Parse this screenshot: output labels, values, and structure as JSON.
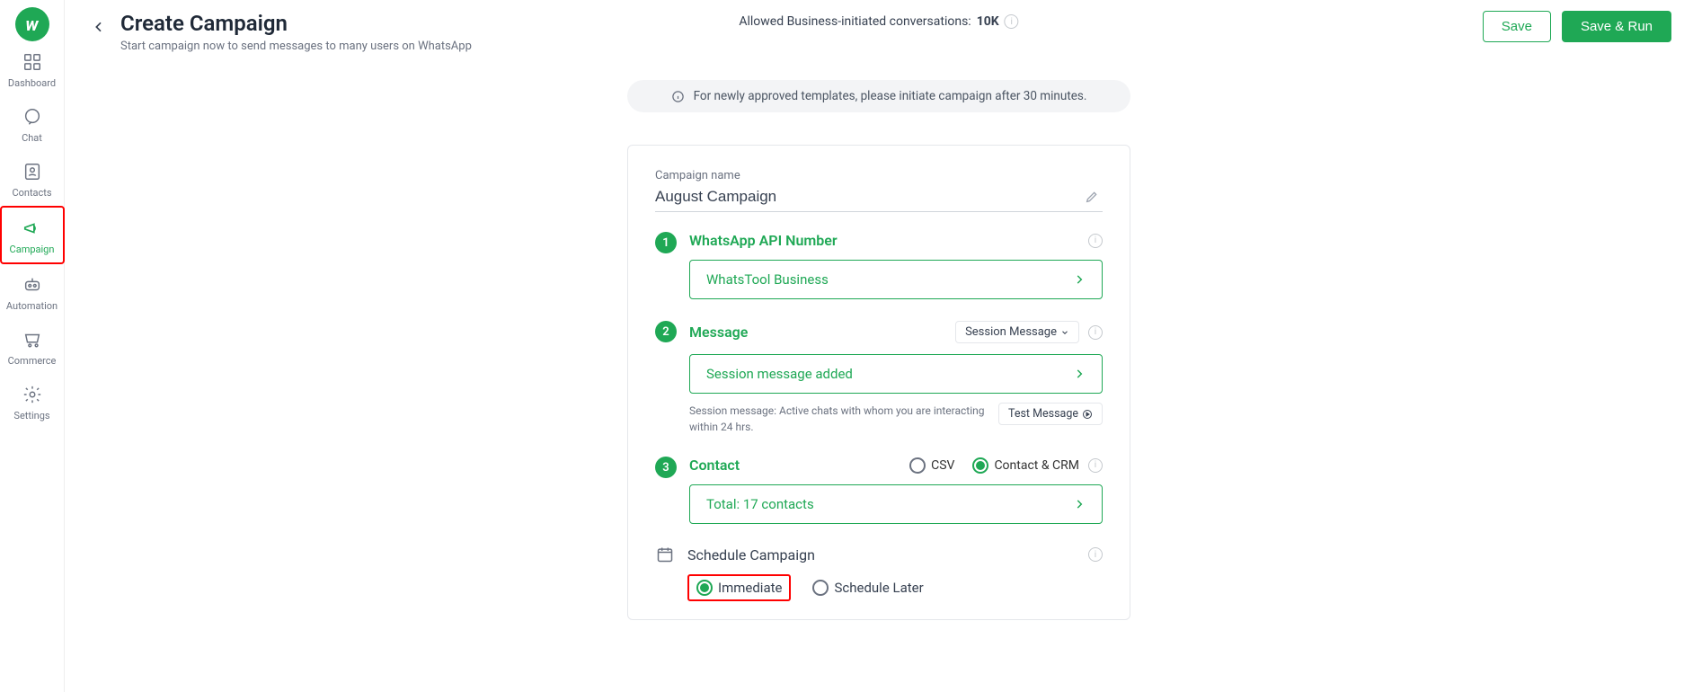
{
  "sidebar": {
    "items": [
      {
        "label": "Dashboard"
      },
      {
        "label": "Chat"
      },
      {
        "label": "Contacts"
      },
      {
        "label": "Campaign"
      },
      {
        "label": "Automation"
      },
      {
        "label": "Commerce"
      },
      {
        "label": "Settings"
      }
    ]
  },
  "header": {
    "title": "Create Campaign",
    "subtitle": "Start campaign now to send messages to many users on WhatsApp",
    "allowed_label": "Allowed Business-initiated conversations: ",
    "allowed_value": "10K",
    "save_label": "Save",
    "save_run_label": "Save & Run"
  },
  "banner": {
    "text": "For newly approved templates, please initiate campaign after 30 minutes."
  },
  "form": {
    "name_label": "Campaign name",
    "name_value": "August Campaign",
    "step1": {
      "num": "1",
      "title": "WhatsApp API Number",
      "selected": "WhatsTool Business"
    },
    "step2": {
      "num": "2",
      "title": "Message",
      "type_label": "Session Message",
      "selected": "Session message added",
      "hint": "Session message: Active chats with whom you are interacting within 24 hrs.",
      "test_label": "Test Message"
    },
    "step3": {
      "num": "3",
      "title": "Contact",
      "opt_csv": "CSV",
      "opt_crm": "Contact & CRM",
      "selected": "Total: 17 contacts"
    },
    "schedule": {
      "title": "Schedule Campaign",
      "opt_immediate": "Immediate",
      "opt_later": "Schedule Later"
    }
  }
}
